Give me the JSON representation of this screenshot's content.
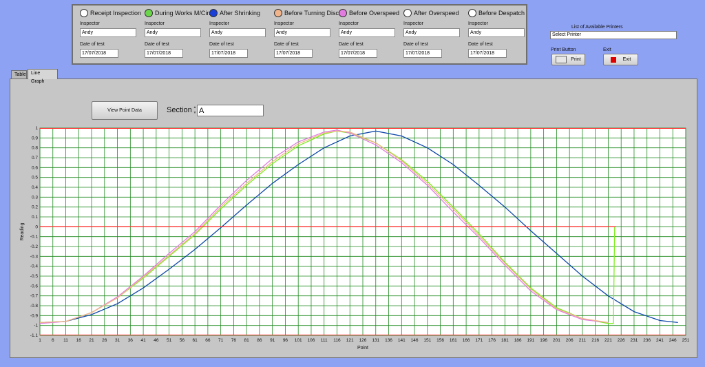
{
  "stages": [
    {
      "label": "Receipt Inspection",
      "radio": "empty",
      "inspector_label": "Inspector",
      "inspector": "Andy",
      "date_label": "Date of test",
      "date": "17/07/2018"
    },
    {
      "label": "During Works M/Cing",
      "radio": "#6bd64a",
      "inspector_label": "Inspector",
      "inspector": "Andy",
      "date_label": "Date of test",
      "date": "17/07/2018"
    },
    {
      "label": "After Shrinking",
      "radio": "#1a3fd8",
      "inspector_label": "Inspector",
      "inspector": "Andy",
      "date_label": "Date of test",
      "date": "17/07/2018"
    },
    {
      "label": "Before Turning Discs",
      "radio": "#f2b48a",
      "inspector_label": "Inspector",
      "inspector": "Andy",
      "date_label": "Date of test",
      "date": "17/07/2018"
    },
    {
      "label": "Before Overspeed",
      "radio": "#e27be0",
      "inspector_label": "Inspector",
      "inspector": "Andy",
      "date_label": "Date of test",
      "date": "17/07/2018"
    },
    {
      "label": "After Overspeed",
      "radio": "empty",
      "inspector_label": "Inspector",
      "inspector": "Andy",
      "date_label": "Date of test",
      "date": "17/07/2018"
    },
    {
      "label": "Before Despatch",
      "radio": "empty",
      "inspector_label": "Inspector",
      "inspector": "Andy",
      "date_label": "Date of test",
      "date": "17/07/2018"
    }
  ],
  "printers": {
    "title": "List of Available Printers",
    "selected": "Select Printer"
  },
  "print_button": {
    "caption": "Print Button",
    "label": "Print"
  },
  "exit_button": {
    "caption": "Exit",
    "label": "Exit"
  },
  "tabs": [
    {
      "label": "Table"
    },
    {
      "label": "Line Graph"
    }
  ],
  "view_point_data": "View Point Data",
  "section": {
    "label": "Section",
    "value": "A"
  },
  "chart_data": {
    "type": "line",
    "xlabel": "Point",
    "ylabel": "Reading",
    "xlim": [
      1,
      251
    ],
    "ylim": [
      -1.1,
      1
    ],
    "x_ticks": [
      1,
      6,
      11,
      16,
      21,
      26,
      31,
      36,
      41,
      46,
      51,
      56,
      61,
      66,
      71,
      76,
      81,
      86,
      91,
      96,
      101,
      106,
      111,
      116,
      121,
      126,
      131,
      136,
      141,
      146,
      151,
      156,
      161,
      166,
      171,
      176,
      181,
      186,
      191,
      196,
      201,
      206,
      211,
      216,
      221,
      226,
      231,
      236,
      241,
      246,
      251
    ],
    "y_ticks": [
      1,
      0.9,
      0.8,
      0.7,
      0.6,
      0.5,
      0.4,
      0.3,
      0.2,
      0.1,
      0,
      -0.1,
      -0.2,
      -0.3,
      -0.4,
      -0.5,
      -0.6,
      -0.7,
      -0.8,
      -0.9,
      -1,
      -1.1
    ],
    "grid": true,
    "series": [
      {
        "color": "#0d47a8",
        "x": [
          1,
          11,
          21,
          31,
          41,
          51,
          61,
          71,
          81,
          91,
          101,
          111,
          121,
          131,
          141,
          151,
          161,
          171,
          181,
          191,
          201,
          211,
          221,
          231,
          241,
          248
        ],
        "y": [
          -0.97,
          -0.96,
          -0.89,
          -0.78,
          -0.62,
          -0.43,
          -0.23,
          -0.01,
          0.22,
          0.44,
          0.63,
          0.8,
          0.92,
          0.97,
          0.92,
          0.8,
          0.63,
          0.42,
          0.2,
          -0.04,
          -0.27,
          -0.5,
          -0.7,
          -0.86,
          -0.95,
          -0.97
        ]
      },
      {
        "color": "#7cf01c",
        "x": [
          1,
          11,
          21,
          31,
          41,
          51,
          61,
          71,
          81,
          91,
          101,
          111,
          116,
          121,
          131,
          141,
          151,
          161,
          171,
          181,
          191,
          201,
          211,
          221,
          223,
          223.5
        ],
        "y": [
          -0.97,
          -0.96,
          -0.87,
          -0.72,
          -0.52,
          -0.3,
          -0.08,
          0.18,
          0.42,
          0.64,
          0.82,
          0.94,
          0.97,
          0.95,
          0.85,
          0.68,
          0.46,
          0.2,
          -0.07,
          -0.36,
          -0.62,
          -0.82,
          -0.93,
          -0.98,
          -0.98,
          0
        ]
      },
      {
        "color": "#e07ce0",
        "x": [
          1,
          11,
          21,
          31,
          41,
          51,
          61,
          71,
          81,
          91,
          101,
          111,
          116,
          121,
          131,
          141,
          151,
          161,
          171,
          181,
          191,
          201,
          211,
          221
        ],
        "y": [
          -0.98,
          -0.96,
          -0.87,
          -0.71,
          -0.5,
          -0.27,
          -0.05,
          0.22,
          0.47,
          0.69,
          0.86,
          0.96,
          0.98,
          0.95,
          0.83,
          0.65,
          0.42,
          0.15,
          -0.11,
          -0.39,
          -0.65,
          -0.84,
          -0.94,
          -0.97
        ]
      },
      {
        "color": "#f2b48a",
        "x": [
          1,
          11,
          21,
          31,
          41,
          51,
          61,
          71,
          81,
          91,
          101,
          111,
          116,
          121,
          131,
          141,
          151,
          161,
          171,
          181,
          191,
          201,
          211,
          221
        ],
        "y": [
          -0.97,
          -0.96,
          -0.87,
          -0.72,
          -0.51,
          -0.29,
          -0.07,
          0.2,
          0.44,
          0.66,
          0.84,
          0.95,
          0.97,
          0.96,
          0.85,
          0.67,
          0.44,
          0.18,
          -0.09,
          -0.37,
          -0.63,
          -0.83,
          -0.93,
          -0.97
        ]
      },
      {
        "color": "#ff3030",
        "x": [
          1,
          224
        ],
        "y": [
          0,
          0
        ]
      }
    ]
  }
}
